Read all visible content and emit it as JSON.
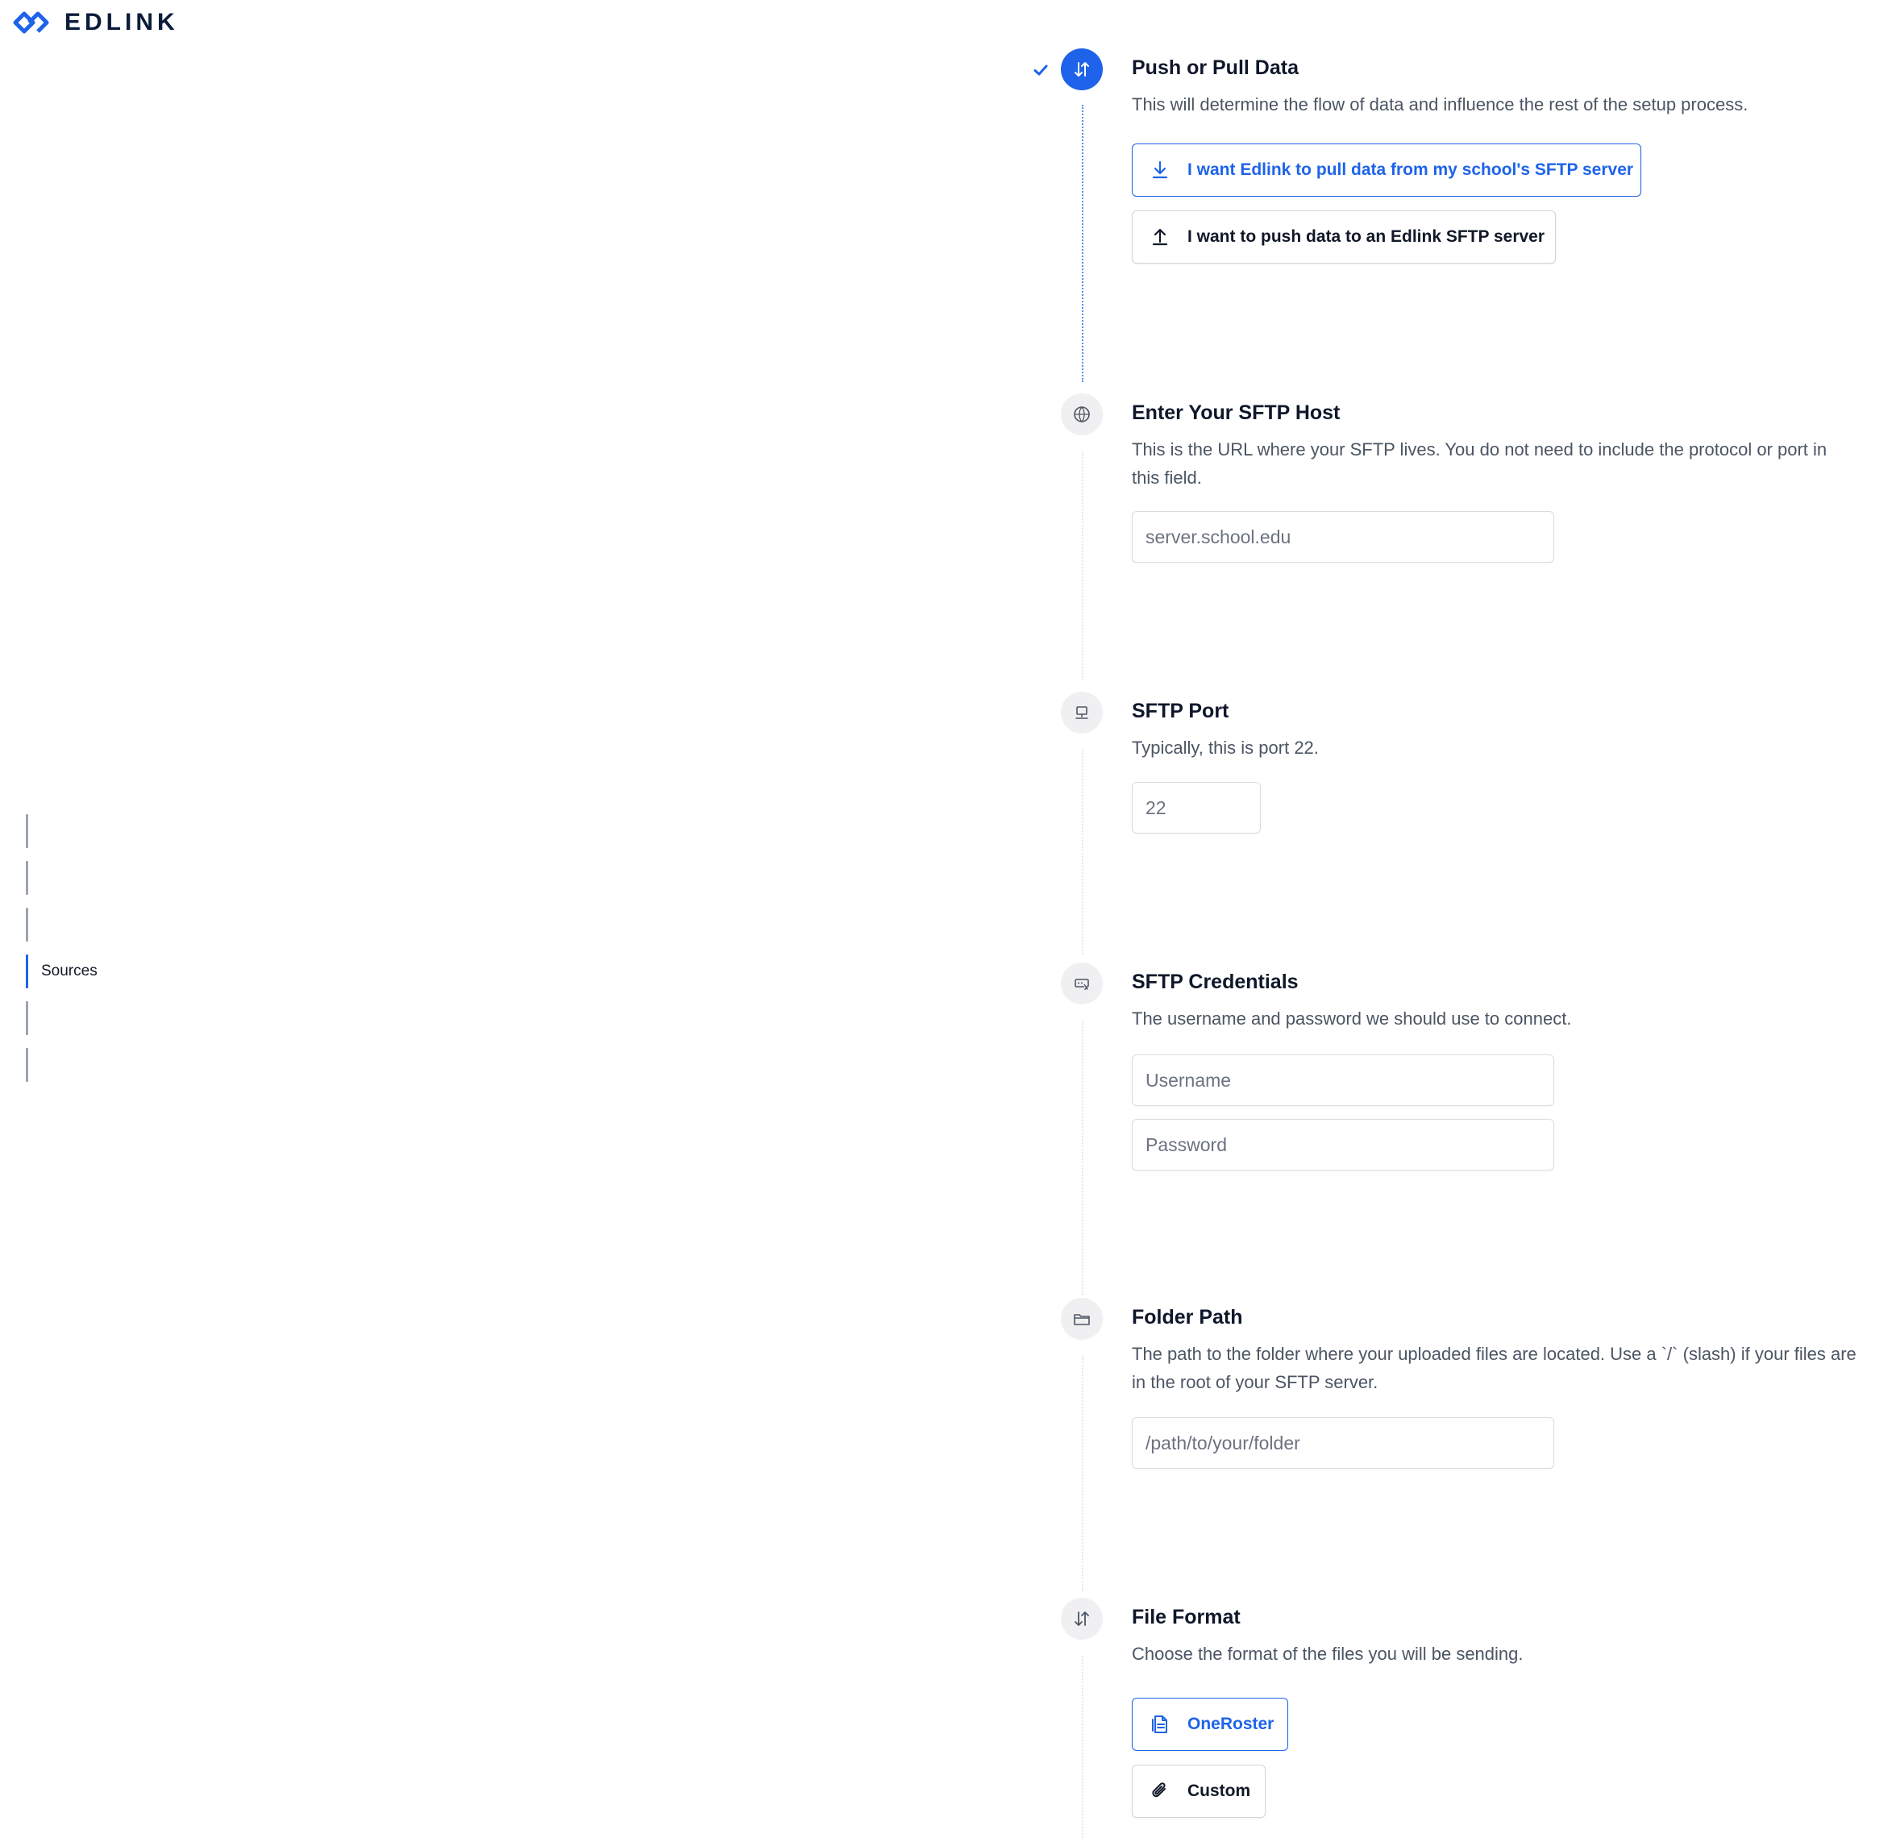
{
  "brand": {
    "name": "EDLINK",
    "accent": "#1e63e9"
  },
  "nav": {
    "items": [
      {
        "label": ""
      },
      {
        "label": ""
      },
      {
        "label": ""
      },
      {
        "label": "Sources",
        "active": true
      },
      {
        "label": ""
      },
      {
        "label": ""
      }
    ]
  },
  "steps": {
    "push_pull": {
      "title": "Push or Pull Data",
      "description": "This will determine the flow of data and influence the rest of the setup process.",
      "icon": "arrows-up-down-icon",
      "completed": true,
      "options": [
        {
          "label": "I want Edlink to pull data from my school's SFTP server",
          "icon": "download-icon",
          "selected": true
        },
        {
          "label": "I want to push data to an Edlink SFTP server",
          "icon": "upload-icon",
          "selected": false
        }
      ]
    },
    "host": {
      "title": "Enter Your SFTP Host",
      "description": "This is the URL where your SFTP lives. You do not need to include the protocol or port in this field.",
      "icon": "globe-www-icon",
      "placeholder": "server.school.edu"
    },
    "port": {
      "title": "SFTP Port",
      "description": "Typically, this is port 22.",
      "icon": "computer-icon",
      "placeholder": "22"
    },
    "credentials": {
      "title": "SFTP Credentials",
      "description": "The username and password we should use to connect.",
      "icon": "password-icon",
      "username_placeholder": "Username",
      "password_placeholder": "Password"
    },
    "folder": {
      "title": "Folder Path",
      "description": "The path to the folder where your uploaded files are located. Use a `/` (slash) if your files are in the root of your SFTP server.",
      "icon": "folder-icon",
      "placeholder": "/path/to/your/folder"
    },
    "format": {
      "title": "File Format",
      "description": "Choose the format of the files you will be sending.",
      "icon": "arrows-up-down-icon",
      "options": [
        {
          "label": "OneRoster",
          "icon": "document-icon",
          "selected": true
        },
        {
          "label": "Custom",
          "icon": "paperclip-icon",
          "selected": false
        }
      ]
    }
  }
}
